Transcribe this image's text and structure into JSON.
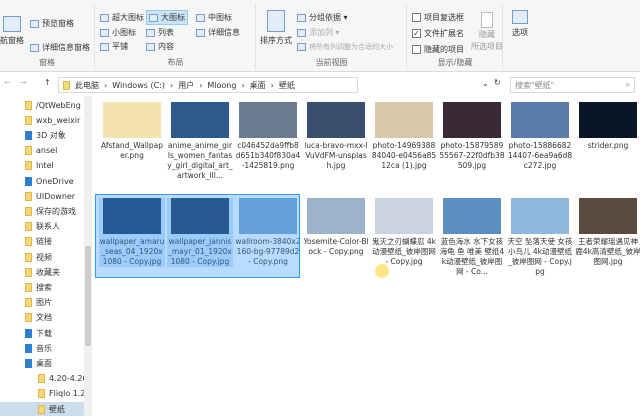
{
  "ribbon": {
    "pane": {
      "nav_pane": "航窗格",
      "preview": "预览窗格",
      "details": "详细信息窗格",
      "group": "窗格"
    },
    "layout": {
      "items": [
        "超大图标",
        "大图标",
        "中图标",
        "小图标",
        "列表",
        "详细信息",
        "平铺",
        "内容"
      ],
      "selected": "大图标",
      "group": "布局"
    },
    "view": {
      "sort": "排序方式",
      "group_by": "分组依据 ▾",
      "add_col": "添加列 ▾",
      "fit_cols": "将所有列调整为合适的大小",
      "group": "当前视图"
    },
    "show": {
      "item_cb": "项目复选框",
      "ext": "文件扩展名",
      "hidden": "隐藏的项目",
      "hide_sel": "隐藏",
      "hide_sel2": "所选项目",
      "group": "显示/隐藏",
      "ext_checked": true
    },
    "options": "选项"
  },
  "address": {
    "crumbs": [
      "此电脑",
      "Windows (C:)",
      "用户",
      "Mloong",
      "桌面",
      "壁纸"
    ],
    "search_placeholder": "搜索\"壁纸\""
  },
  "nav": [
    "/QtWebEng",
    "wxb_weixir",
    "3D 对象",
    "ansel",
    "Intel",
    "OneDrive",
    "UIDowner",
    "保存的游戏",
    "联系人",
    "链接",
    "视频",
    "收藏夹",
    "搜索",
    "图片",
    "文档",
    "下载",
    "音乐",
    "桌面",
    "4.20-4.26",
    "Fliqlo 1.2",
    "壁纸"
  ],
  "files": [
    {
      "name": "Afstand_Wallpaper.png",
      "color": "#f3e3b0"
    },
    {
      "name": "anime_anime_girls_women_fantasy_girl_digital_art_artwork_ill...",
      "color": "#2c5a8a"
    },
    {
      "name": "c046452da9ffb8d651b340f830a4-1425819.png",
      "color": "#6a7d90"
    },
    {
      "name": "luca-bravo-mxx-lVuVdFM-unsplash.jpg",
      "color": "#38506e"
    },
    {
      "name": "photo-1496938884040-e0456a8512ca (1).jpg",
      "color": "#d8c7a8"
    },
    {
      "name": "photo-1587958955567-22f0dfb38509.jpg",
      "color": "#3a2a35"
    },
    {
      "name": "photo-1588668214407-6ea9a6d8c272.jpg",
      "color": "#5a7ca8"
    },
    {
      "name": "strider.png",
      "color": "#0a1525"
    },
    {
      "name": "wallpaper_amaru_seas_04_1920x1080 - Copy.jpg",
      "color": "#1d3b5e"
    },
    {
      "name": "wallpaper_jannis_mayr_01_1920x1080 - Copy.jpg",
      "color": "#203a55"
    },
    {
      "name": "wallroom-3840x2160-bg-97789d2 - Copy.png",
      "color": "#7fa6c8"
    },
    {
      "name": "Yosemite-Color-Block - Copy.png",
      "color": "#9db3c9"
    },
    {
      "name": "鬼灭之刃蝴蝶忍 4k动漫壁纸_彼岸图网 - Copy.jpg",
      "color": "#c9d4e0"
    },
    {
      "name": "蓝色海水 水下女孩 海龟 鱼 唯美 壁纸4k动漫壁纸_彼岸图网 - Co...",
      "color": "#5a8fc0"
    },
    {
      "name": "天空 坠落天使 女孩 小鸟儿 4k动漫壁纸_彼岸图网 - Copy.jpg",
      "color": "#8fb8de"
    },
    {
      "name": "王者荣耀瑶遇见神鹿4k高清壁纸_彼岸图网.jpg",
      "color": "#5a4a40"
    }
  ]
}
